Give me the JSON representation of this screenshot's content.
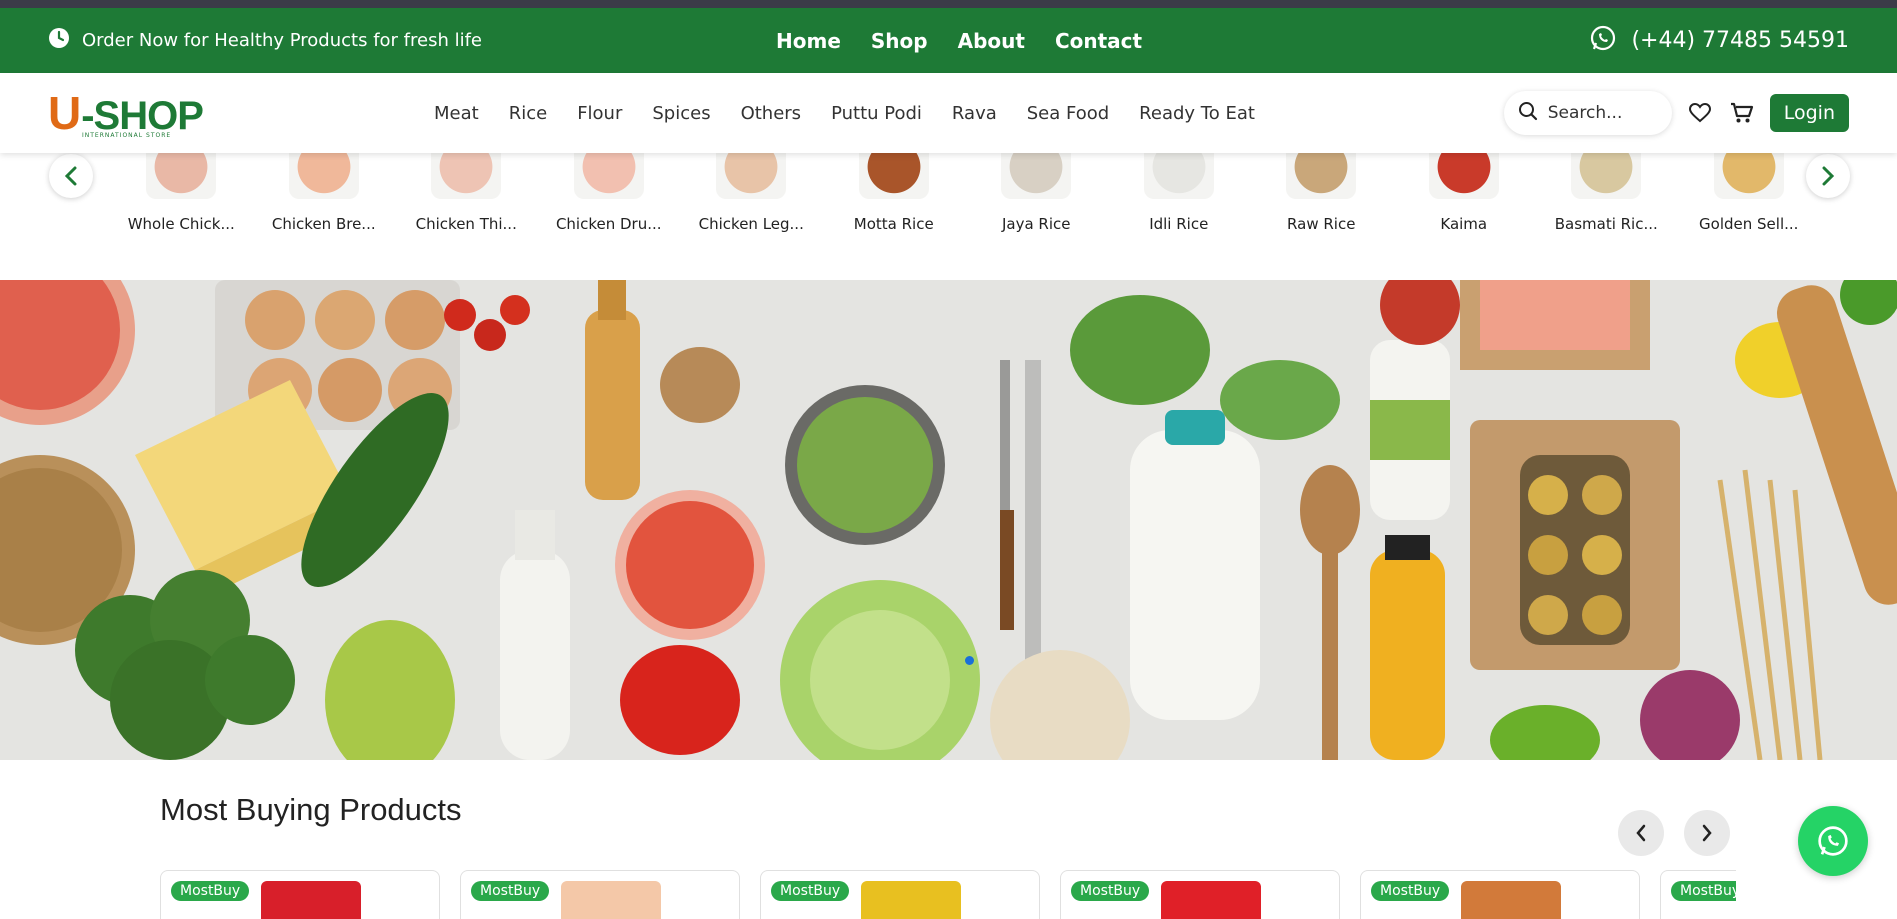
{
  "topbar": {
    "promo_text": "Order Now for Healthy Products for fresh life",
    "nav": [
      "Home",
      "Shop",
      "About",
      "Contact"
    ],
    "phone": "(+44) 77485 54591"
  },
  "header": {
    "logo_u": "U",
    "logo_rest": "-SHOP",
    "logo_sub": "INTERNATIONAL STORE",
    "categories": [
      "Meat",
      "Rice",
      "Flour",
      "Spices",
      "Others",
      "Puttu Podi",
      "Rava",
      "Sea Food",
      "Ready To Eat"
    ],
    "search_placeholder": "Search...",
    "login_label": "Login"
  },
  "category_strip": {
    "items": [
      "Whole Chick...",
      "Chicken Bre...",
      "Chicken Thi...",
      "Chicken Dru...",
      "Chicken Leg...",
      "Motta Rice",
      "Jaya Rice",
      "Idli Rice",
      "Raw Rice",
      "Kaima",
      "Basmati Ric...",
      "Golden Sell..."
    ],
    "image_colors": [
      "#e9b8a6",
      "#f0b89a",
      "#eec4b4",
      "#f2c0b0",
      "#e8c4a8",
      "#a9552a",
      "#d8d0c4",
      "#e6e6e2",
      "#c9a77a",
      "#c93a2a",
      "#d8c8a0",
      "#e2b86a"
    ]
  },
  "hero": {
    "active_slide": 1
  },
  "most_buying": {
    "title": "Most Buying Products",
    "badge": "MostBuy",
    "product_colors": [
      "#d81f2a",
      "#f4c8a8",
      "#e8c020",
      "#e02028",
      "#d27a3a",
      "#c8c8c8"
    ]
  },
  "colors": {
    "brand_green": "#1e7a36",
    "accent_orange": "#e06a16",
    "whatsapp_green": "#25d366"
  }
}
